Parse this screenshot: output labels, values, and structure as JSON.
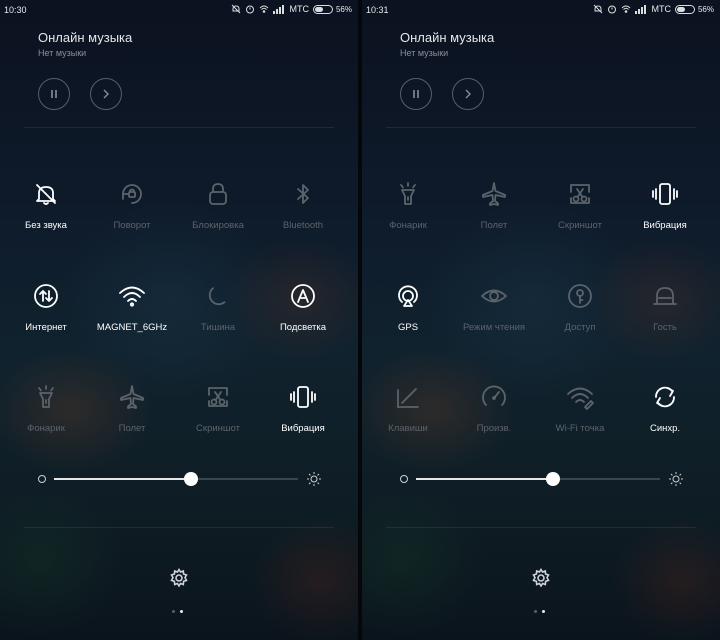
{
  "screens": [
    {
      "status_time": "10:30",
      "carrier": "МТС",
      "battery": "56%",
      "music_title": "Онлайн музыка",
      "music_subtitle": "Нет музыки",
      "brightness": 0.56,
      "page_index": 1,
      "tiles": [
        {
          "label": "Без звука",
          "icon": "bell-off-icon",
          "active": true
        },
        {
          "label": "Поворот",
          "icon": "rotation-lock-icon",
          "active": false
        },
        {
          "label": "Блокировка",
          "icon": "lock-icon",
          "active": false
        },
        {
          "label": "Bluetooth",
          "icon": "bluetooth-icon",
          "active": false
        },
        {
          "label": "Интернет",
          "icon": "mobile-data-icon",
          "active": true
        },
        {
          "label": "MAGNET_6GHz",
          "icon": "wifi-icon",
          "active": true
        },
        {
          "label": "Тишина",
          "icon": "moon-icon",
          "active": false
        },
        {
          "label": "Подсветка",
          "icon": "auto-brightness-icon",
          "active": true
        },
        {
          "label": "Фонарик",
          "icon": "flashlight-icon",
          "active": false
        },
        {
          "label": "Полет",
          "icon": "airplane-icon",
          "active": false
        },
        {
          "label": "Скриншот",
          "icon": "screenshot-icon",
          "active": false
        },
        {
          "label": "Вибрация",
          "icon": "vibration-icon",
          "active": true
        }
      ]
    },
    {
      "status_time": "10:31",
      "carrier": "МТС",
      "battery": "56%",
      "music_title": "Онлайн музыка",
      "music_subtitle": "Нет музыки",
      "brightness": 0.56,
      "page_index": 1,
      "tiles": [
        {
          "label": "Фонарик",
          "icon": "flashlight-icon",
          "active": false
        },
        {
          "label": "Полет",
          "icon": "airplane-icon",
          "active": false
        },
        {
          "label": "Скриншот",
          "icon": "screenshot-icon",
          "active": false
        },
        {
          "label": "Вибрация",
          "icon": "vibration-icon",
          "active": true
        },
        {
          "label": "GPS",
          "icon": "gps-icon",
          "active": true
        },
        {
          "label": "Режим чтения",
          "icon": "eye-icon",
          "active": false
        },
        {
          "label": "Доступ",
          "icon": "hotspot-access-icon",
          "active": false
        },
        {
          "label": "Гость",
          "icon": "guest-icon",
          "active": false
        },
        {
          "label": "Клавиши",
          "icon": "keys-icon",
          "active": false
        },
        {
          "label": "Произв.",
          "icon": "performance-icon",
          "active": false
        },
        {
          "label": "Wi-Fi точка",
          "icon": "wifi-hotspot-icon",
          "active": false
        },
        {
          "label": "Синхр.",
          "icon": "sync-icon",
          "active": true
        }
      ]
    }
  ],
  "colors": {
    "active": "#ffffff",
    "inactive": "#5c636b"
  }
}
